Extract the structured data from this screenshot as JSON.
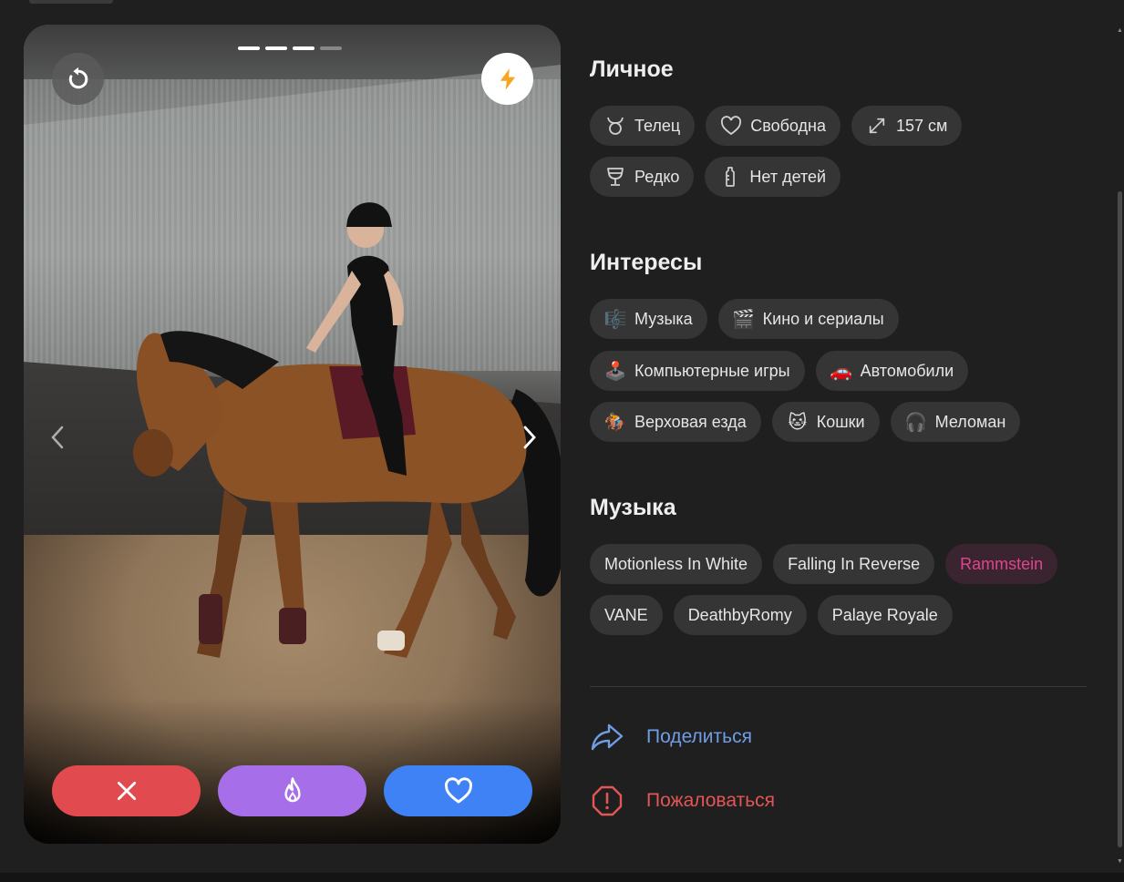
{
  "colors": {
    "background": "#1f1f1f",
    "chip": "#353535",
    "dislike": "#e14b4f",
    "superlike": "#a66ee8",
    "like": "#3f82f6",
    "share": "#6f9ee6",
    "report": "#e25656",
    "highlight_text": "#e0448f"
  },
  "photo": {
    "progress_total": 4,
    "progress_active": 3,
    "icons": {
      "undo": "undo-icon",
      "boost": "lightning-icon",
      "prev": "chevron-left-icon",
      "next": "chevron-right-icon"
    }
  },
  "actions": {
    "dislike_icon": "close-icon",
    "superlike_icon": "flame-icon",
    "like_icon": "heart-icon"
  },
  "personal": {
    "title": "Личное",
    "chips": [
      {
        "icon": "taurus-icon",
        "label": "Телец"
      },
      {
        "icon": "heart-outline-icon",
        "label": "Свободна"
      },
      {
        "icon": "height-icon",
        "label": "157 см"
      },
      {
        "icon": "wine-glass-icon",
        "label": "Редко"
      },
      {
        "icon": "baby-bottle-icon",
        "label": "Нет детей"
      }
    ]
  },
  "interests": {
    "title": "Интересы",
    "chips": [
      {
        "icon": "🎼",
        "label": "Музыка"
      },
      {
        "icon": "🎬",
        "label": "Кино и сериалы"
      },
      {
        "icon": "🕹️",
        "label": "Компьютерные игры"
      },
      {
        "icon": "🚗",
        "label": "Автомобили"
      },
      {
        "icon": "🏇",
        "label": "Верховая езда"
      },
      {
        "icon": "🐱",
        "label": "Кошки"
      },
      {
        "icon": "🎧",
        "label": "Меломан"
      }
    ]
  },
  "music": {
    "title": "Музыка",
    "chips": [
      {
        "label": "Motionless In White"
      },
      {
        "label": "Falling In Reverse"
      },
      {
        "label": "Rammstein",
        "highlighted": true
      },
      {
        "label": "VANE"
      },
      {
        "label": "DeathbyRomy"
      },
      {
        "label": "Palaye Royale"
      }
    ]
  },
  "links": {
    "share": "Поделиться",
    "report": "Пожаловаться"
  }
}
